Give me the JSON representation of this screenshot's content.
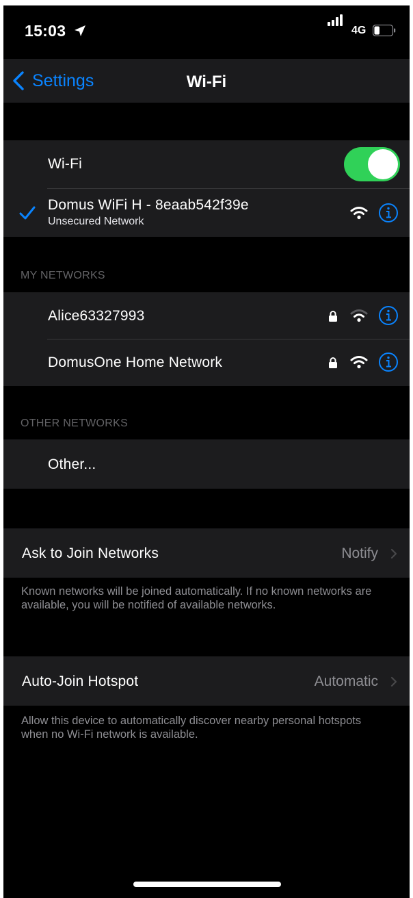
{
  "status_bar": {
    "time": "15:03",
    "network": "4G",
    "battery_level": 0.3
  },
  "nav": {
    "back_label": "Settings",
    "title": "Wi-Fi"
  },
  "wifi_toggle": {
    "label": "Wi-Fi",
    "on": true,
    "on_color": "#30d158"
  },
  "connected": {
    "name": "Domus WiFi H - 8eaab542f39e",
    "status": "Unsecured Network"
  },
  "my_networks": {
    "header": "MY NETWORKS",
    "items": [
      {
        "name": "Alice63327993",
        "secured": true,
        "signal_bars": 2
      },
      {
        "name": "DomusOne Home Network",
        "secured": true,
        "signal_bars": 3
      }
    ]
  },
  "other_networks": {
    "header": "OTHER NETWORKS",
    "other_label": "Other..."
  },
  "ask_to_join": {
    "label": "Ask to Join Networks",
    "value": "Notify",
    "footer": "Known networks will be joined automatically. If no known networks are available, you will be notified of available networks."
  },
  "auto_join_hotspot": {
    "label": "Auto-Join Hotspot",
    "value": "Automatic",
    "footer": "Allow this device to automatically discover nearby personal hotspots when no Wi-Fi network is available."
  },
  "colors": {
    "accent": "#0a84ff",
    "background": "#000000",
    "cell": "#1c1c1e",
    "secondary_text": "#8e8e93"
  }
}
